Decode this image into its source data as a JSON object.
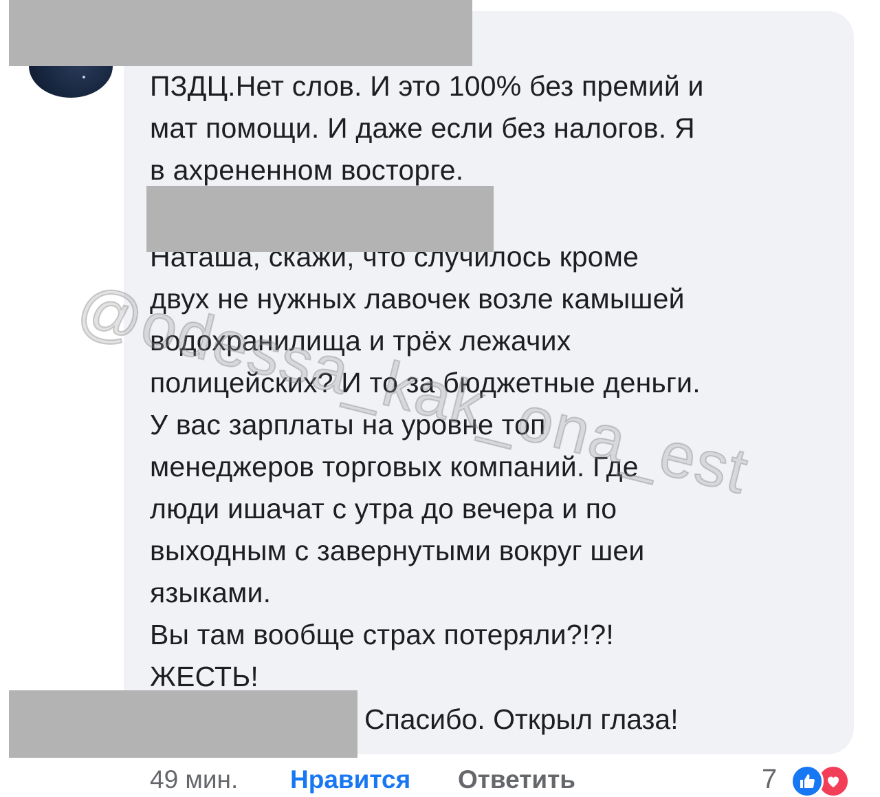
{
  "comment": {
    "paragraph1": [
      "ПЗДЦ.Нет слов. И это 100% без премий и",
      "мат помощи. И даже если без налогов. Я",
      "в ахрененном восторге."
    ],
    "paragraph2": [
      "Наташа, скажи, что случилось кроме",
      "двух не нужных лавочек возле камышей",
      "водохранилища и трёх лежачих",
      "полицейских? И то за бюджетные деньги.",
      "У вас зарплаты на уровне топ",
      "менеджеров торговых компаний. Где",
      "люди ишачат с утра до вечера и по",
      "выходным с завернутыми вокруг шеи",
      "языками.",
      "Вы там вообще страх потеряли?!?!",
      "ЖЕСТЬ!"
    ],
    "closing": "Спасибо. Открыл глаза!"
  },
  "watermark": "@odessa_kak_ona_est",
  "footer": {
    "time": "49 мин.",
    "like_label": "Нравится",
    "reply_label": "Ответить",
    "reaction_count": "7"
  },
  "icons": {
    "like": "thumbs-up-icon",
    "love": "heart-icon"
  },
  "colors": {
    "bubble": "#f0f2f5",
    "link": "#1877f2",
    "love": "#f33e58",
    "redaction": "#b3b3b3"
  }
}
